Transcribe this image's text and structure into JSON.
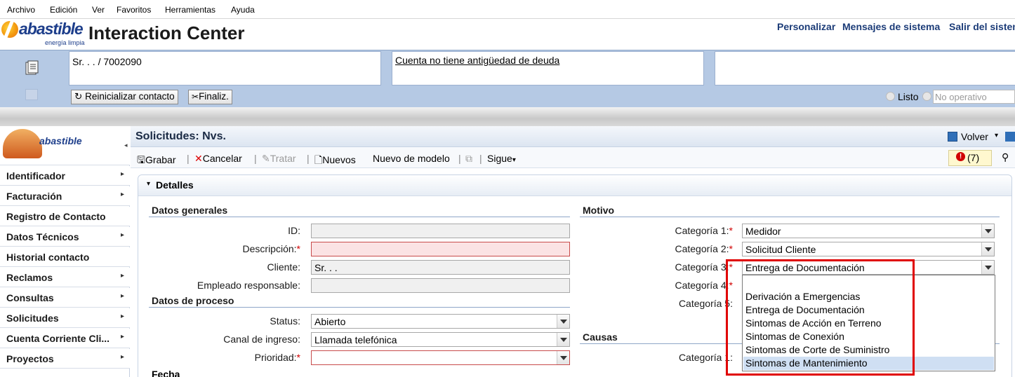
{
  "menubar": [
    "Archivo",
    "Edición",
    "Ver",
    "Favoritos",
    "Herramientas",
    "Ayuda"
  ],
  "header": {
    "logo_text": "abastible",
    "logo_tagline": "energía limpia",
    "title": "Interaction Center",
    "links": [
      "Personalizar",
      "Mensajes de sistema",
      "Salir del sistema"
    ]
  },
  "contact": {
    "customer": "Sr. . . / 7002090",
    "debt_link": "Cuenta no tiene antigüedad de deuda",
    "reset_button": "Reinicializar contacto",
    "finish_button": "Finaliz.",
    "status_ready": "Listo",
    "status_not_operative": "No operativo"
  },
  "sidebar": {
    "logo_text": "abastible",
    "items": [
      {
        "label": "Identificador",
        "arrow": "▸"
      },
      {
        "label": "Facturación",
        "arrow": "▸"
      },
      {
        "label": "Registro de Contacto",
        "arrow": ""
      },
      {
        "label": "Datos Técnicos",
        "arrow": "▸"
      },
      {
        "label": "Historial contacto",
        "arrow": ""
      },
      {
        "label": "Reclamos",
        "arrow": "▸"
      },
      {
        "label": "Consultas",
        "arrow": "▸"
      },
      {
        "label": "Solicitudes",
        "arrow": "▸"
      },
      {
        "label": "Cuenta Corriente Cli...",
        "arrow": "▸"
      },
      {
        "label": "Proyectos",
        "arrow": "▸"
      }
    ]
  },
  "page": {
    "title": "Solicitudes: Nvs.",
    "back_label": "Volver",
    "messages_count": "(7)"
  },
  "toolbar": {
    "save": "Grabar",
    "cancel": "Cancelar",
    "process": "Tratar",
    "new": "Nuevos",
    "new_from_template": "Nuevo de modelo",
    "next": "Sigue"
  },
  "details": {
    "title": "Detalles",
    "general": {
      "heading": "Datos generales",
      "id_label": "ID:",
      "id_value": "",
      "desc_label": "Descripción:",
      "desc_value": "",
      "client_label": "Cliente:",
      "client_value": "Sr. . .",
      "employee_label": "Empleado responsable:",
      "employee_value": ""
    },
    "process": {
      "heading": "Datos de proceso",
      "status_label": "Status:",
      "status_value": "Abierto",
      "channel_label": "Canal de ingreso:",
      "channel_value": "Llamada telefónica",
      "priority_label": "Prioridad:",
      "priority_value": ""
    },
    "next_heading": "Fecha",
    "motivo": {
      "heading": "Motivo",
      "cat1_label": "Categoría 1:",
      "cat1_value": "Medidor",
      "cat2_label": "Categoría 2:",
      "cat2_value": "Solicitud Cliente",
      "cat3_label": "Categoría 3:",
      "cat3_value": "Entrega de Documentación",
      "cat4_label": "Categoría 4:",
      "cat5_label": "Categoría 5:"
    },
    "causas": {
      "heading": "Causas",
      "cat1_label": "Categoría 1:"
    }
  },
  "dropdown": {
    "options": [
      "",
      "Derivación a Emergencias",
      "Entrega de Documentación",
      "Sintomas de Acción en Terreno",
      "Sintomas de Conexión",
      "Sintomas de Corte de Suministro",
      "Sintomas de Mantenimiento"
    ],
    "highlighted_index": 6
  },
  "colors": {
    "brand_blue": "#1d3e8b",
    "contact_area": "#b5c9e4",
    "required_red": "#d10000",
    "annotation_red": "#e00000",
    "highlight": "#cfdff3"
  }
}
